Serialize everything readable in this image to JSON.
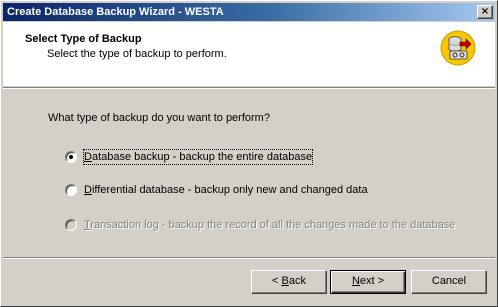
{
  "window": {
    "title": "Create Database Backup Wizard - WESTA",
    "close_glyph": "×"
  },
  "header": {
    "title": "Select Type of Backup",
    "subtitle": "Select the type of backup to perform.",
    "icon": "database-backup-icon"
  },
  "question": "What type of backup do you want to perform?",
  "options": [
    {
      "accel": "D",
      "rest": "atabase backup - backup the entire database",
      "selected": true,
      "enabled": true
    },
    {
      "accel": "D",
      "rest": "ifferential database - backup only new and changed data",
      "selected": false,
      "enabled": true
    },
    {
      "accel": "T",
      "rest": "ransaction log - backup the record of all the changes made to the database",
      "selected": false,
      "enabled": false
    }
  ],
  "buttons": {
    "back_prefix": "< ",
    "back_accel": "B",
    "back_rest": "ack",
    "next_accel": "N",
    "next_rest": "ext >",
    "cancel": "Cancel"
  },
  "colors": {
    "titlebar_start": "#0a246a",
    "titlebar_end": "#a6caf0",
    "face": "#d4d0c8",
    "icon_yellow": "#f5c800"
  }
}
